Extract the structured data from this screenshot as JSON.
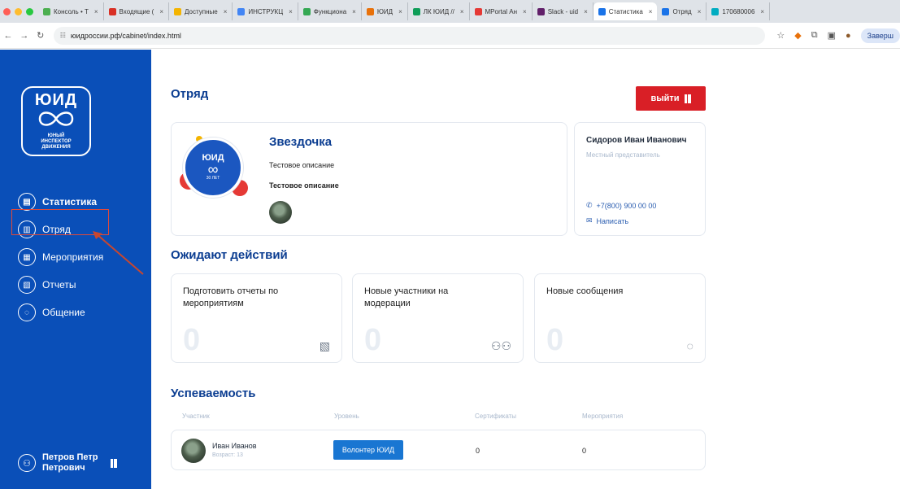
{
  "browser": {
    "tabs": [
      {
        "label": "Консоль • Т",
        "color": "#4caf50"
      },
      {
        "label": "Входящие (",
        "color": "#d93025"
      },
      {
        "label": "Доступные",
        "color": "#f4b400"
      },
      {
        "label": "ИНСТРУКЦ",
        "color": "#4285f4"
      },
      {
        "label": "Функциона",
        "color": "#34a853"
      },
      {
        "label": "ЮИД",
        "color": "#e8710a"
      },
      {
        "label": "ЛК ЮИД //",
        "color": "#0f9d58"
      },
      {
        "label": "MPortal Ан",
        "color": "#e53935"
      },
      {
        "label": "Slack - uid",
        "color": "#611f69"
      },
      {
        "label": "Статистика",
        "color": "#1a73e8",
        "active": true
      },
      {
        "label": "Отряд",
        "color": "#1a73e8"
      },
      {
        "label": "170680006",
        "color": "#00acc1"
      }
    ],
    "url": "юидроссии.рф/cabinet/index.html",
    "finish_label": "Заверш"
  },
  "sidebar": {
    "logo_title": "ЮИД",
    "logo_sub": [
      "ЮНЫЙ",
      "ИНСПЕКТОР",
      "ДВИЖЕНИЯ"
    ],
    "items": [
      {
        "label": "Статистика",
        "icon": "chart-icon"
      },
      {
        "label": "Отряд",
        "icon": "team-icon"
      },
      {
        "label": "Мероприятия",
        "icon": "calendar-icon"
      },
      {
        "label": "Отчеты",
        "icon": "report-icon"
      },
      {
        "label": "Общение",
        "icon": "chat-icon"
      }
    ],
    "user_name": "Петров Петр Петрович"
  },
  "team": {
    "section_title": "Отряд",
    "exit_label": "выйти",
    "name": "Звездочка",
    "desc": "Тестовое описание",
    "desc_bold": "Тестовое описание",
    "logo_title": "ЮИД",
    "logo_years": "30 ЛЕТ"
  },
  "rep": {
    "name": "Сидоров Иван Иванович",
    "role": "Местный представитель",
    "phone": "+7(800) 900 00 00",
    "write": "Написать"
  },
  "actions": {
    "title": "Ожидают действий",
    "cards": [
      {
        "title": "Подготовить отчеты по мероприятиям",
        "count": "0",
        "icon": "report-icon"
      },
      {
        "title": "Новые участники на модерации",
        "count": "0",
        "icon": "users-icon"
      },
      {
        "title": "Новые сообщения",
        "count": "0",
        "icon": "chat-icon"
      }
    ]
  },
  "progress": {
    "title": "Успеваемость",
    "headers": [
      "Участник",
      "Уровень",
      "Сертификаты",
      "Мероприятия"
    ],
    "rows": [
      {
        "name": "Иван Иванов",
        "age": "Возраст: 13",
        "level": "Волонтер ЮИД",
        "certificates": "0",
        "events": "0"
      }
    ]
  }
}
